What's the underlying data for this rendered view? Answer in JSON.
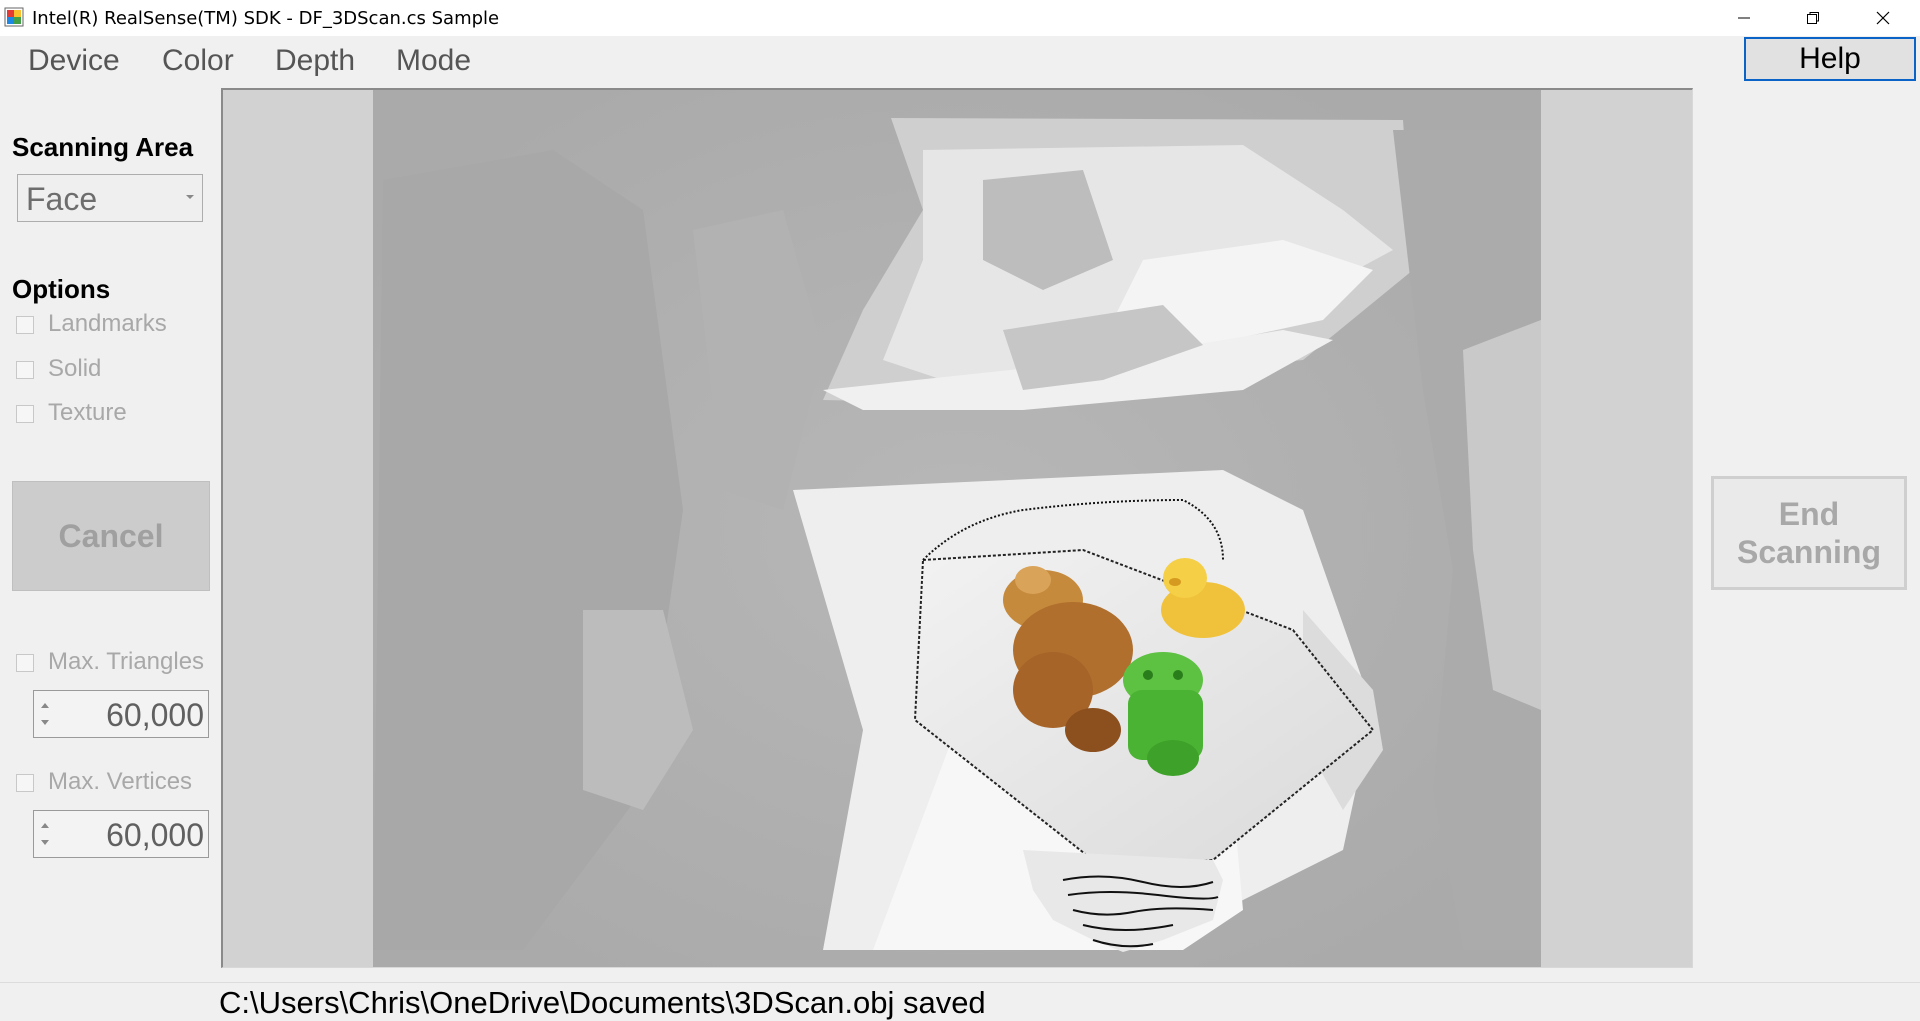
{
  "window": {
    "title": "Intel(R) RealSense(TM) SDK - DF_3DScan.cs Sample"
  },
  "menu": {
    "items": [
      "Device",
      "Color",
      "Depth",
      "Mode"
    ],
    "help_label": "Help"
  },
  "left_panel": {
    "scanning_area_label": "Scanning Area",
    "scanning_area_value": "Face",
    "options_label": "Options",
    "options": [
      {
        "label": "Landmarks",
        "checked": false
      },
      {
        "label": "Solid",
        "checked": false
      },
      {
        "label": "Texture",
        "checked": false
      }
    ],
    "cancel_label": "Cancel",
    "max_triangles": {
      "label": "Max. Triangles",
      "value": "60,000",
      "checked": false
    },
    "max_vertices": {
      "label": "Max. Vertices",
      "value": "60,000",
      "checked": false
    }
  },
  "right_panel": {
    "end_scanning_label": "End Scanning"
  },
  "status": {
    "message": "C:\\Users\\Chris\\OneDrive\\Documents\\3DScan.obj saved"
  },
  "colors": {
    "accent": "#0a64c8",
    "disabled_text": "#a8a8a8",
    "window_bg": "#f0f0f0"
  }
}
